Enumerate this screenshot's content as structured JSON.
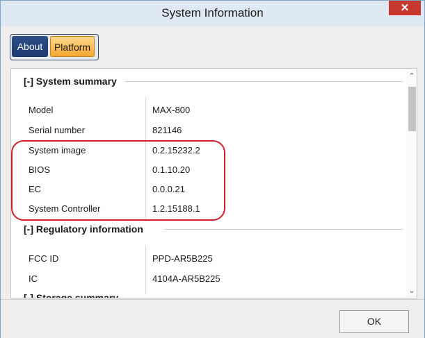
{
  "window": {
    "title": "System Information",
    "close_label": "✕"
  },
  "tabs": [
    {
      "label": "About",
      "active": false
    },
    {
      "label": "Platform",
      "active": true
    }
  ],
  "sections": {
    "system_summary": {
      "header": "[-] System summary",
      "rows": [
        {
          "label": "Model",
          "value": "MAX-800"
        },
        {
          "label": "Serial number",
          "value": "821146"
        },
        {
          "label": "System image",
          "value": "0.2.15232.2"
        },
        {
          "label": "BIOS",
          "value": "0.1.10.20"
        },
        {
          "label": "EC",
          "value": "0.0.0.21"
        },
        {
          "label": "System Controller",
          "value": "1.2.15188.1"
        }
      ]
    },
    "regulatory": {
      "header": "[-] Regulatory information",
      "rows": [
        {
          "label": "FCC ID",
          "value": "PPD-AR5B225"
        },
        {
          "label": "IC",
          "value": "4104A-AR5B225"
        }
      ]
    },
    "storage": {
      "header": "[-] Storage summary"
    }
  },
  "footer": {
    "ok_label": "OK"
  },
  "colors": {
    "highlight": "#d21f2b",
    "tab_active": "#f5a733",
    "tab_inactive": "#1d3a70",
    "close": "#c7392f"
  }
}
